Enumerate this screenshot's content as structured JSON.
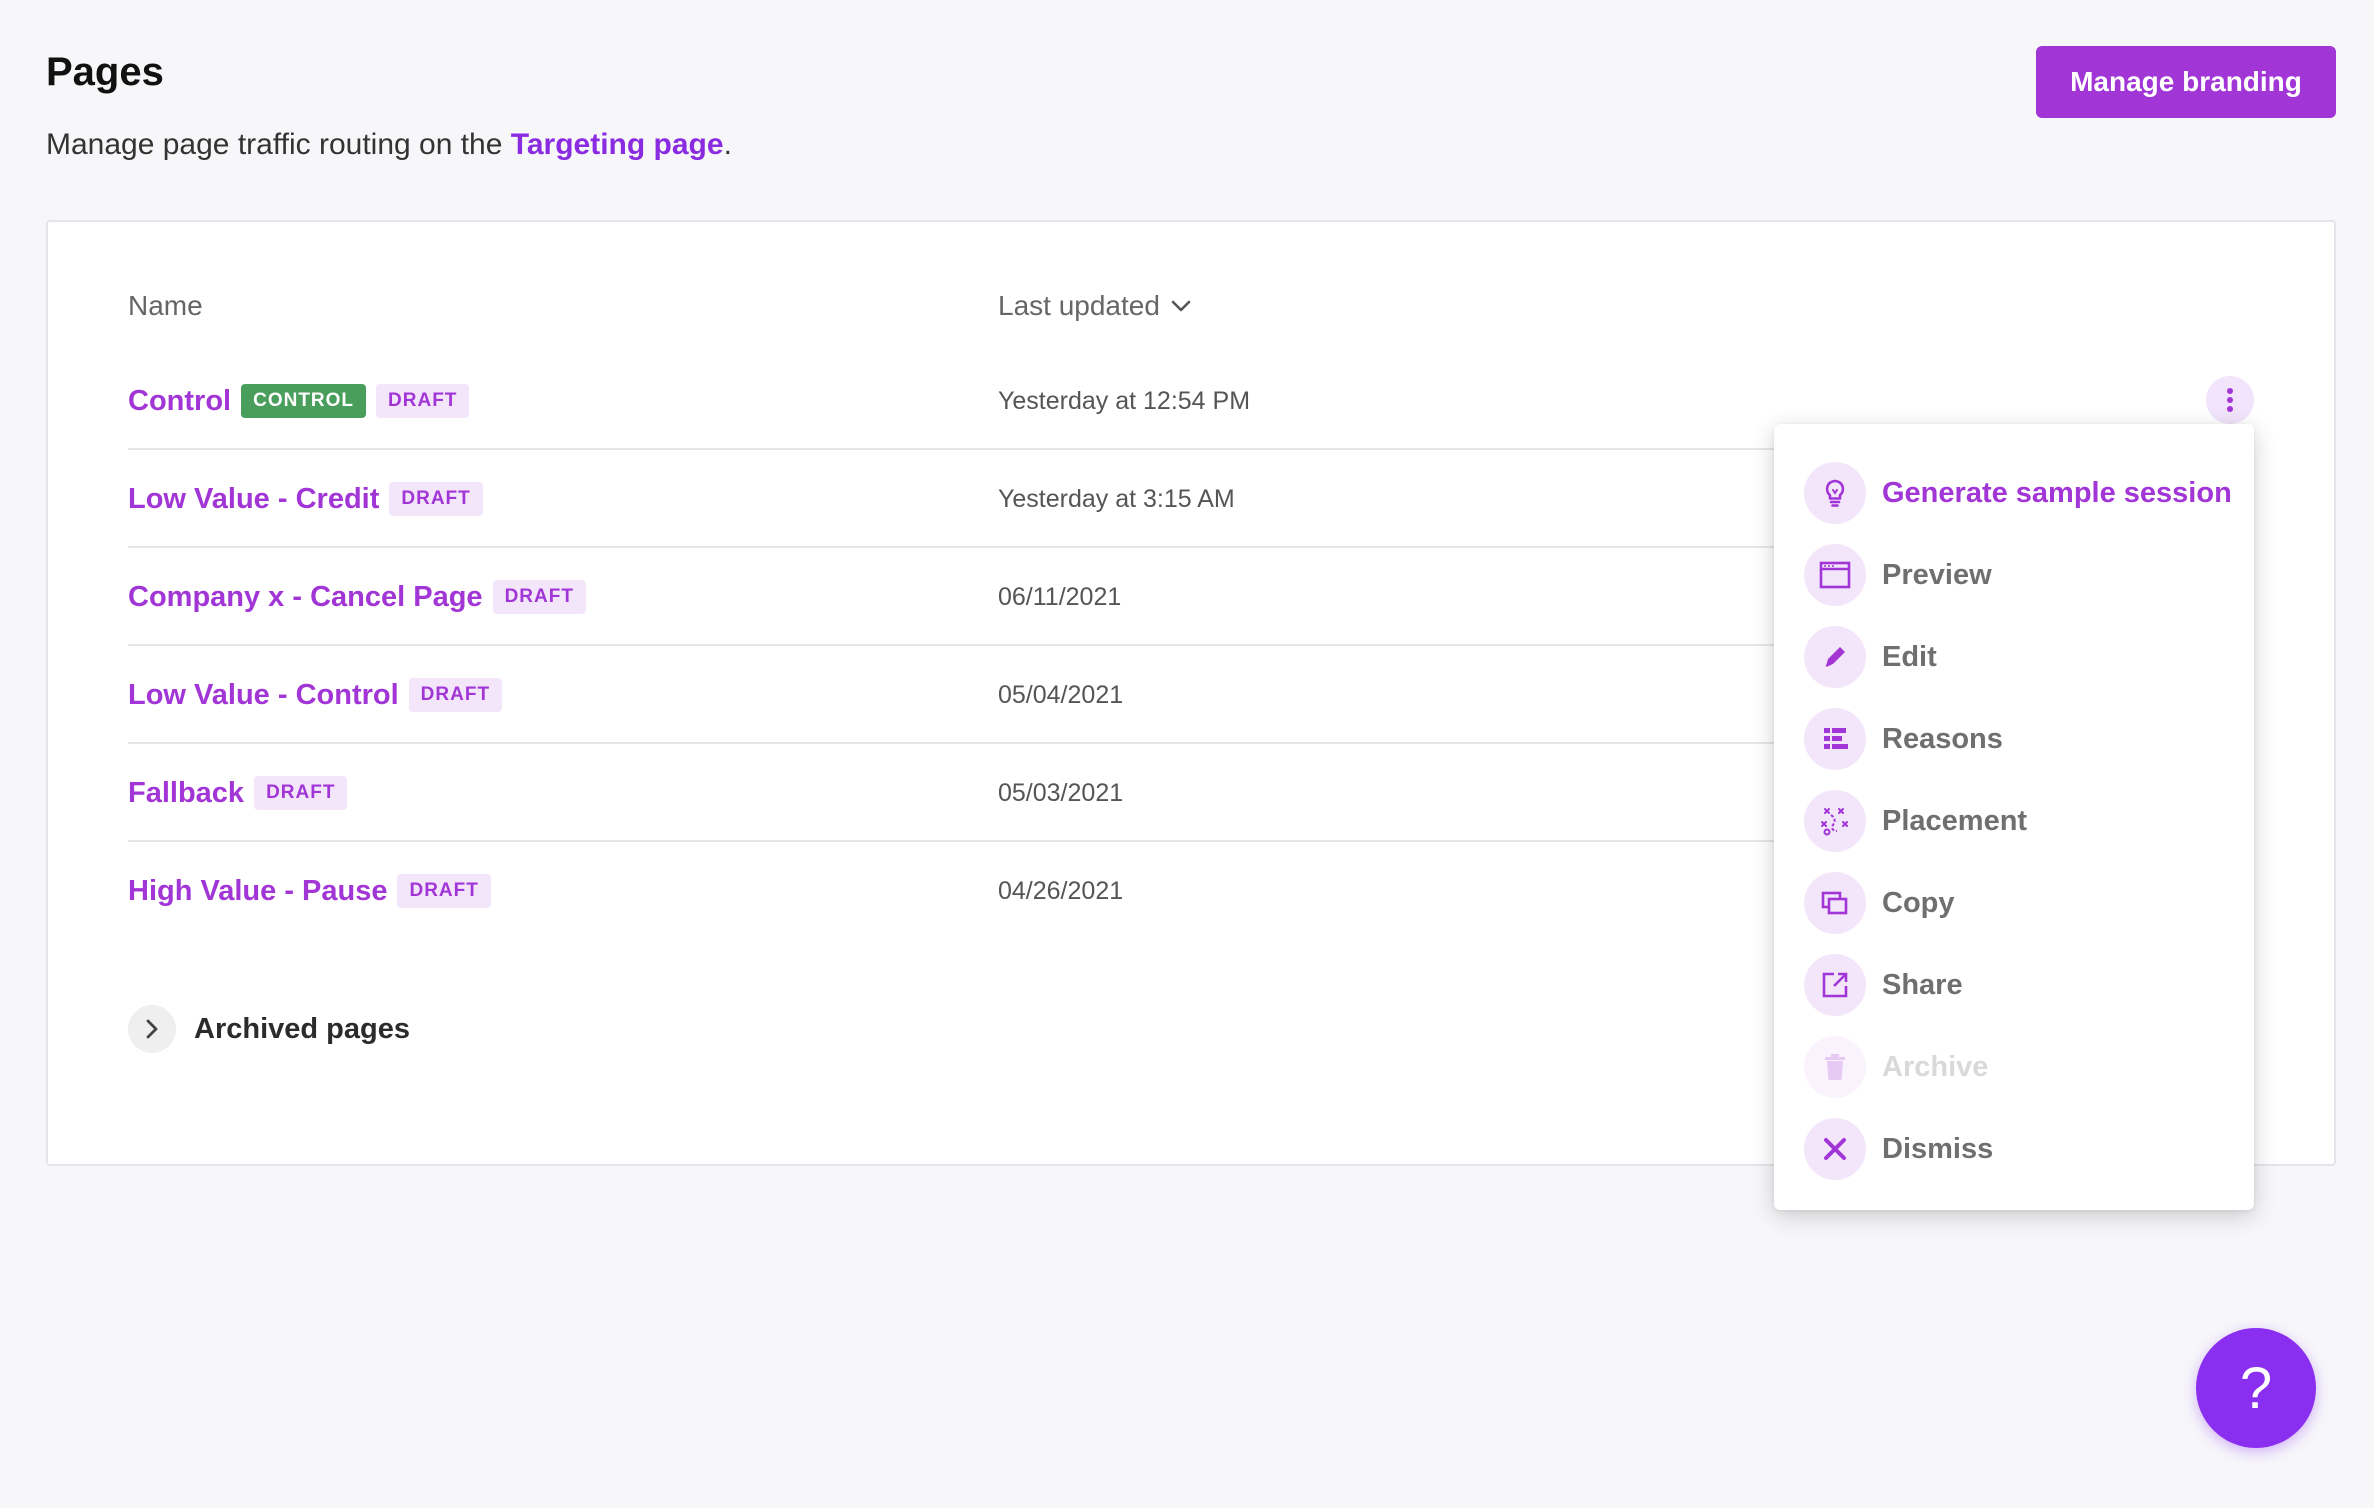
{
  "header": {
    "title": "Pages",
    "subtitle_prefix": "Manage page traffic routing on the ",
    "subtitle_link": "Targeting page",
    "subtitle_suffix": ".",
    "brand_button": "Manage branding"
  },
  "table": {
    "col_name": "Name",
    "col_updated": "Last updated",
    "rows": [
      {
        "name": "Control",
        "badges": [
          "CONTROL",
          "DRAFT"
        ],
        "updated": "Yesterday at 12:54 PM"
      },
      {
        "name": "Low Value - Credit",
        "badges": [
          "DRAFT"
        ],
        "updated": "Yesterday at 3:15 AM"
      },
      {
        "name": "Company x - Cancel Page",
        "badges": [
          "DRAFT"
        ],
        "updated": "06/11/2021"
      },
      {
        "name": "Low Value - Control",
        "badges": [
          "DRAFT"
        ],
        "updated": "05/04/2021"
      },
      {
        "name": "Fallback",
        "badges": [
          "DRAFT"
        ],
        "updated": "05/03/2021"
      },
      {
        "name": "High Value - Pause",
        "badges": [
          "DRAFT"
        ],
        "updated": "04/26/2021"
      }
    ]
  },
  "archived": {
    "label": "Archived pages"
  },
  "menu": {
    "items": [
      {
        "label": "Generate sample session",
        "icon": "lightbulb-icon",
        "state": "primary"
      },
      {
        "label": "Preview",
        "icon": "browser-window-icon",
        "state": "normal"
      },
      {
        "label": "Edit",
        "icon": "pencil-icon",
        "state": "normal"
      },
      {
        "label": "Reasons",
        "icon": "reasons-list-icon",
        "state": "normal"
      },
      {
        "label": "Placement",
        "icon": "placement-icon",
        "state": "normal"
      },
      {
        "label": "Copy",
        "icon": "copy-icon",
        "state": "normal"
      },
      {
        "label": "Share",
        "icon": "share-icon",
        "state": "normal"
      },
      {
        "label": "Archive",
        "icon": "trash-icon",
        "state": "disabled"
      },
      {
        "label": "Dismiss",
        "icon": "close-icon",
        "state": "normal"
      }
    ]
  },
  "help": {
    "label": "?"
  },
  "colors": {
    "accent": "#a135d6",
    "control_badge": "#4a9e5c",
    "help_button": "#8a2ef0"
  }
}
